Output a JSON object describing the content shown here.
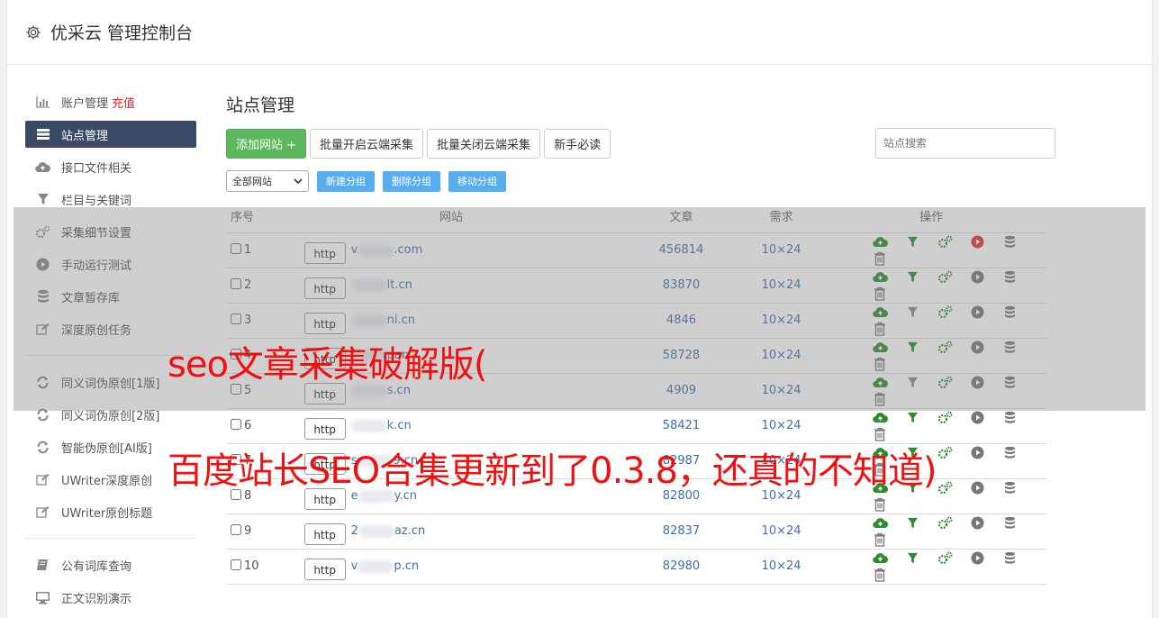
{
  "header": {
    "title": "优采云 管理控制台"
  },
  "sidebar": {
    "group1": [
      {
        "label": "账户管理",
        "extra": "充值",
        "icon": "bar-chart-icon"
      },
      {
        "label": "站点管理",
        "icon": "server-icon",
        "active": true
      },
      {
        "label": "接口文件相关",
        "icon": "cloud-upload-icon"
      },
      {
        "label": "栏目与关键词",
        "icon": "filter-icon"
      },
      {
        "label": "采集细节设置",
        "icon": "gears-icon"
      },
      {
        "label": "手动运行测试",
        "icon": "play-icon"
      },
      {
        "label": "文章暂存库",
        "icon": "database-icon"
      },
      {
        "label": "深度原创任务",
        "icon": "edit-icon"
      }
    ],
    "group2": [
      {
        "label": "同义词伪原创[1版]",
        "icon": "refresh-icon"
      },
      {
        "label": "同义词伪原创[2版]",
        "icon": "refresh-icon"
      },
      {
        "label": "智能伪原创[AI版]",
        "icon": "refresh-icon"
      },
      {
        "label": "UWriter深度原创",
        "icon": "edit-icon"
      },
      {
        "label": "UWriter原创标题",
        "icon": "edit-icon"
      }
    ],
    "group3": [
      {
        "label": "公有词库查询",
        "icon": "book-icon"
      },
      {
        "label": "正文识别演示",
        "icon": "monitor-icon"
      }
    ]
  },
  "main": {
    "title": "站点管理",
    "toolbar": {
      "add": "添加网站 +",
      "enable_cloud": "批量开启云端采集",
      "disable_cloud": "批量关闭云端采集",
      "guide": "新手必读",
      "search_placeholder": "站点搜索"
    },
    "group_select": "全部网站",
    "group_buttons": {
      "new": "新建分组",
      "delete": "删除分组",
      "move": "移动分组"
    },
    "columns": [
      "序号",
      "网站",
      "文章",
      "需求",
      "操作"
    ],
    "rows": [
      {
        "no": "1",
        "http": "http",
        "pre": "v",
        "post": ".com",
        "articles": "456814",
        "req": "10×24",
        "green_filter": true,
        "run": true
      },
      {
        "no": "2",
        "http": "http",
        "pre": "",
        "post": "lt.cn",
        "articles": "83870",
        "req": "10×24",
        "green_filter": true,
        "run": false
      },
      {
        "no": "3",
        "http": "http",
        "pre": "",
        "post": "ni.cn",
        "articles": "4846",
        "req": "10×24",
        "green_filter": false,
        "run": false
      },
      {
        "no": "4",
        "http": "http",
        "pre": "",
        "post": "pan",
        "articles": "58728",
        "req": "10×24",
        "green_filter": true,
        "run": false
      },
      {
        "no": "5",
        "http": "http",
        "pre": "",
        "post": "s.cn",
        "articles": "4909",
        "req": "10×24",
        "green_filter": false,
        "run": false
      },
      {
        "no": "6",
        "http": "http",
        "pre": "",
        "post": "k.cn",
        "articles": "58421",
        "req": "10×24",
        "green_filter": true,
        "run": false
      },
      {
        "no": "7",
        "http": "http",
        "pre": "s",
        "post": "9.cn",
        "articles": "82987",
        "req": "10×24",
        "green_filter": true,
        "run": false
      },
      {
        "no": "8",
        "http": "http",
        "pre": "e",
        "post": "y.cn",
        "articles": "82800",
        "req": "10×24",
        "green_filter": true,
        "run": false
      },
      {
        "no": "9",
        "http": "http",
        "pre": "2",
        "post": "az.cn",
        "articles": "82837",
        "req": "10×24",
        "green_filter": true,
        "run": false
      },
      {
        "no": "10",
        "http": "http",
        "pre": "v",
        "post": "p.cn",
        "articles": "82980",
        "req": "10×24",
        "green_filter": true,
        "run": false
      }
    ]
  },
  "overlay": {
    "caption1": "seo文章采集破解版(",
    "caption2": "百度站长SEO合集更新到了0.3.8，还真的不知道)"
  },
  "colors": {
    "sidebar_active": "#3a4a66",
    "green": "#5cb85c",
    "blue_btn": "#56aef0",
    "link": "#3a6fb0",
    "caption": "#f01010"
  }
}
